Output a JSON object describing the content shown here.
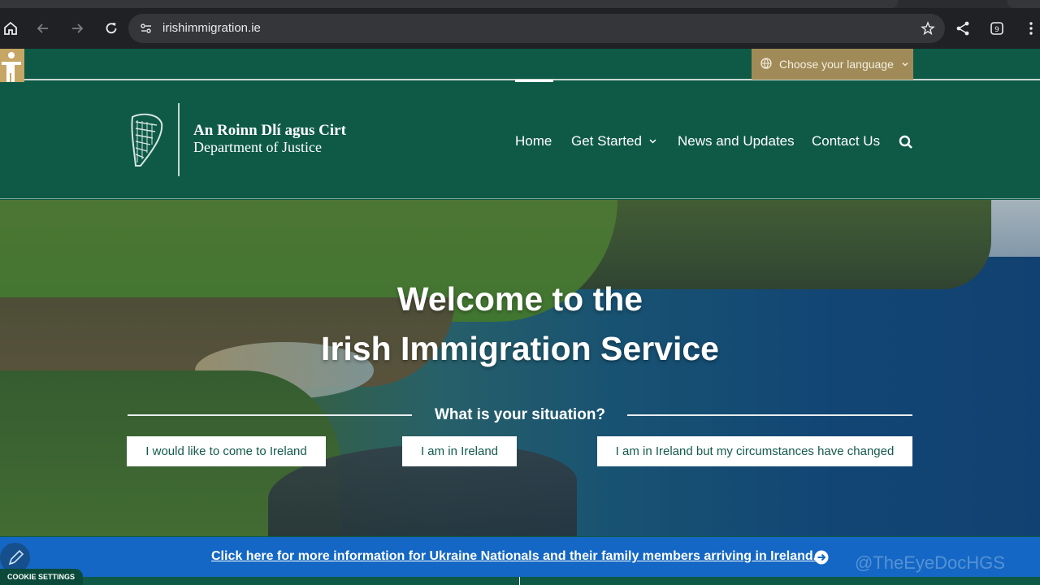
{
  "browser": {
    "url": "irishimmigration.ie",
    "icons": [
      "home-icon",
      "back-icon",
      "forward-icon",
      "reload-icon",
      "site-settings-icon",
      "star-icon",
      "share-icon",
      "tabs-icon",
      "menu-icon"
    ],
    "tab_count": "9"
  },
  "utility": {
    "language_label": "Choose your language"
  },
  "logo": {
    "line1": "An Roinn Dlí agus Cirt",
    "line2": "Department of Justice"
  },
  "nav": {
    "home": "Home",
    "get_started": "Get Started",
    "news": "News and Updates",
    "contact": "Contact Us"
  },
  "hero": {
    "title_line1": "Welcome to the",
    "title_line2": "Irish Immigration Service",
    "situation": "What is your situation?",
    "buttons": [
      "I would like to come to Ireland",
      "I am in Ireland",
      "I am in Ireland but my circumstances have changed"
    ]
  },
  "banner": {
    "ukraine_link": "Click here for more information for Ukraine Nationals and their family members arriving in Ireland."
  },
  "cookie": {
    "label": "COOKIE SETTINGS"
  },
  "watermark": "@TheEyeDocHGS",
  "colors": {
    "brand_green": "#0e5a47",
    "gold": "#a08a57",
    "banner_blue": "#1467c4"
  }
}
